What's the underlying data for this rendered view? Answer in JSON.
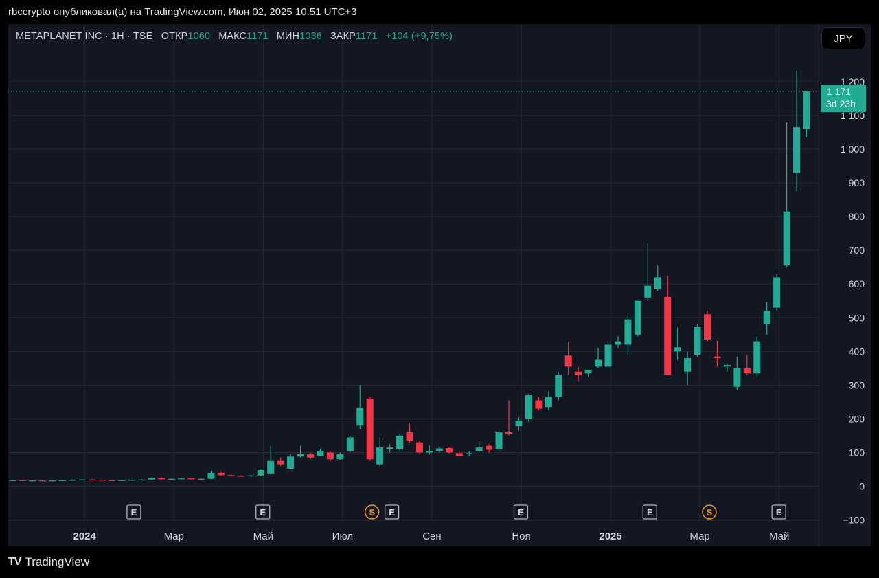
{
  "caption": "rbccrypto опубликовал(а) на TradingView.com, Июн 02, 2025 10:51 UTC+3",
  "legend": {
    "symbol": "METAPLANET INC · 1Н · TSE",
    "open_label": "ОТКР",
    "open": "1060",
    "high_label": "МАКС",
    "high": "1171",
    "low_label": "МИН",
    "low": "1036",
    "close_label": "ЗАКР",
    "close": "1171",
    "change": "+104 (+9,75%)"
  },
  "currency_button": "JPY",
  "price_badge": {
    "price": "1 171",
    "countdown": "3d 23h"
  },
  "brand": {
    "logo": "TV",
    "name": "TradingView"
  },
  "colors": {
    "up": "#22ab94",
    "down": "#f23645",
    "grid": "#252a36",
    "background": "#131722"
  },
  "chart_data": {
    "type": "candlestick",
    "y_ticks": [
      -100,
      0,
      100,
      200,
      300,
      400,
      500,
      600,
      700,
      800,
      900,
      1000,
      1100,
      1200
    ],
    "y_tick_labels": [
      "−100",
      "0",
      "100",
      "200",
      "300",
      "400",
      "500",
      "600",
      "700",
      "800",
      "900",
      "1 000",
      "1 100",
      "1 200"
    ],
    "x_ticks": [
      {
        "label": "2024",
        "week": 6,
        "bold": true
      },
      {
        "label": "Мар",
        "week": 15
      },
      {
        "label": "Май",
        "week": 24
      },
      {
        "label": "Июл",
        "week": 32
      },
      {
        "label": "Сен",
        "week": 41
      },
      {
        "label": "Ноя",
        "week": 50
      },
      {
        "label": "2025",
        "week": 59,
        "bold": true
      },
      {
        "label": "Мар",
        "week": 68
      },
      {
        "label": "Май",
        "week": 76
      }
    ],
    "events": [
      {
        "type": "E",
        "week": 12
      },
      {
        "type": "E",
        "week": 25
      },
      {
        "type": "S",
        "week": 36
      },
      {
        "type": "E",
        "week": 38
      },
      {
        "type": "E",
        "week": 51
      },
      {
        "type": "E",
        "week": 64
      },
      {
        "type": "S",
        "week": 70
      },
      {
        "type": "E",
        "week": 77
      }
    ],
    "last_price": 1171,
    "candles": [
      [
        0,
        17,
        19,
        16,
        18
      ],
      [
        1,
        18,
        19,
        16,
        17
      ],
      [
        2,
        17,
        18,
        16,
        17
      ],
      [
        3,
        17,
        18,
        15,
        16
      ],
      [
        4,
        16,
        18,
        15,
        17
      ],
      [
        5,
        17,
        19,
        16,
        18
      ],
      [
        6,
        18,
        20,
        17,
        19
      ],
      [
        7,
        19,
        21,
        18,
        20
      ],
      [
        8,
        20,
        21,
        18,
        19
      ],
      [
        9,
        19,
        20,
        17,
        18
      ],
      [
        10,
        18,
        19,
        16,
        17
      ],
      [
        11,
        17,
        19,
        16,
        18
      ],
      [
        12,
        18,
        20,
        17,
        19
      ],
      [
        13,
        19,
        21,
        18,
        20
      ],
      [
        14,
        20,
        27,
        19,
        25
      ],
      [
        15,
        25,
        27,
        19,
        21
      ],
      [
        16,
        21,
        23,
        19,
        22
      ],
      [
        17,
        22,
        24,
        20,
        23
      ],
      [
        18,
        23,
        24,
        20,
        21
      ],
      [
        19,
        21,
        23,
        19,
        22
      ],
      [
        20,
        22,
        45,
        20,
        40
      ],
      [
        21,
        40,
        42,
        31,
        33
      ],
      [
        22,
        33,
        36,
        30,
        31
      ],
      [
        23,
        31,
        33,
        29,
        30
      ],
      [
        24,
        30,
        34,
        29,
        32
      ],
      [
        25,
        32,
        50,
        30,
        48
      ],
      [
        26,
        38,
        120,
        37,
        75
      ],
      [
        27,
        75,
        85,
        60,
        65
      ],
      [
        28,
        52,
        95,
        50,
        88
      ],
      [
        29,
        88,
        120,
        85,
        95
      ],
      [
        30,
        95,
        100,
        80,
        85
      ],
      [
        31,
        90,
        110,
        88,
        105
      ],
      [
        32,
        100,
        105,
        75,
        80
      ],
      [
        33,
        80,
        100,
        78,
        95
      ],
      [
        34,
        105,
        150,
        100,
        145
      ],
      [
        35,
        180,
        300,
        170,
        232
      ],
      [
        36,
        260,
        265,
        75,
        80
      ],
      [
        37,
        65,
        145,
        60,
        115
      ],
      [
        38,
        110,
        125,
        100,
        115
      ],
      [
        39,
        110,
        155,
        105,
        150
      ],
      [
        40,
        160,
        185,
        130,
        135
      ],
      [
        41,
        130,
        135,
        95,
        100
      ],
      [
        42,
        100,
        120,
        95,
        105
      ],
      [
        43,
        105,
        118,
        100,
        112
      ],
      [
        44,
        113,
        116,
        97,
        100
      ],
      [
        45,
        98,
        105,
        88,
        90
      ],
      [
        46,
        95,
        105,
        90,
        98
      ],
      [
        47,
        105,
        135,
        100,
        115
      ],
      [
        48,
        120,
        125,
        100,
        108
      ],
      [
        49,
        110,
        165,
        105,
        160
      ],
      [
        50,
        160,
        255,
        150,
        155
      ],
      [
        51,
        178,
        205,
        165,
        195
      ],
      [
        52,
        200,
        275,
        190,
        270
      ],
      [
        53,
        255,
        265,
        225,
        230
      ],
      [
        54,
        235,
        280,
        225,
        265
      ],
      [
        55,
        265,
        340,
        255,
        330
      ],
      [
        56,
        388,
        428,
        330,
        355
      ],
      [
        57,
        340,
        355,
        310,
        330
      ],
      [
        58,
        335,
        345,
        325,
        345
      ],
      [
        59,
        355,
        410,
        350,
        375
      ],
      [
        60,
        355,
        430,
        350,
        420
      ],
      [
        61,
        420,
        445,
        410,
        430
      ],
      [
        62,
        420,
        505,
        390,
        495
      ],
      [
        63,
        450,
        550,
        445,
        550
      ],
      [
        64,
        560,
        720,
        550,
        595
      ],
      [
        65,
        585,
        655,
        580,
        620
      ],
      [
        66,
        562,
        625,
        330,
        330
      ],
      [
        67,
        400,
        470,
        375,
        412
      ],
      [
        68,
        340,
        400,
        300,
        380
      ],
      [
        69,
        390,
        480,
        385,
        472
      ],
      [
        70,
        510,
        520,
        430,
        435
      ],
      [
        71,
        385,
        432,
        355,
        380
      ],
      [
        72,
        355,
        365,
        340,
        360
      ],
      [
        73,
        295,
        385,
        285,
        350
      ],
      [
        74,
        350,
        390,
        330,
        335
      ],
      [
        75,
        335,
        445,
        325,
        430
      ],
      [
        76,
        480,
        545,
        450,
        520
      ],
      [
        77,
        530,
        630,
        520,
        620
      ],
      [
        78,
        655,
        1080,
        650,
        815
      ],
      [
        79,
        930,
        1230,
        875,
        1065
      ],
      [
        80,
        1060,
        1171,
        1036,
        1171
      ]
    ]
  }
}
